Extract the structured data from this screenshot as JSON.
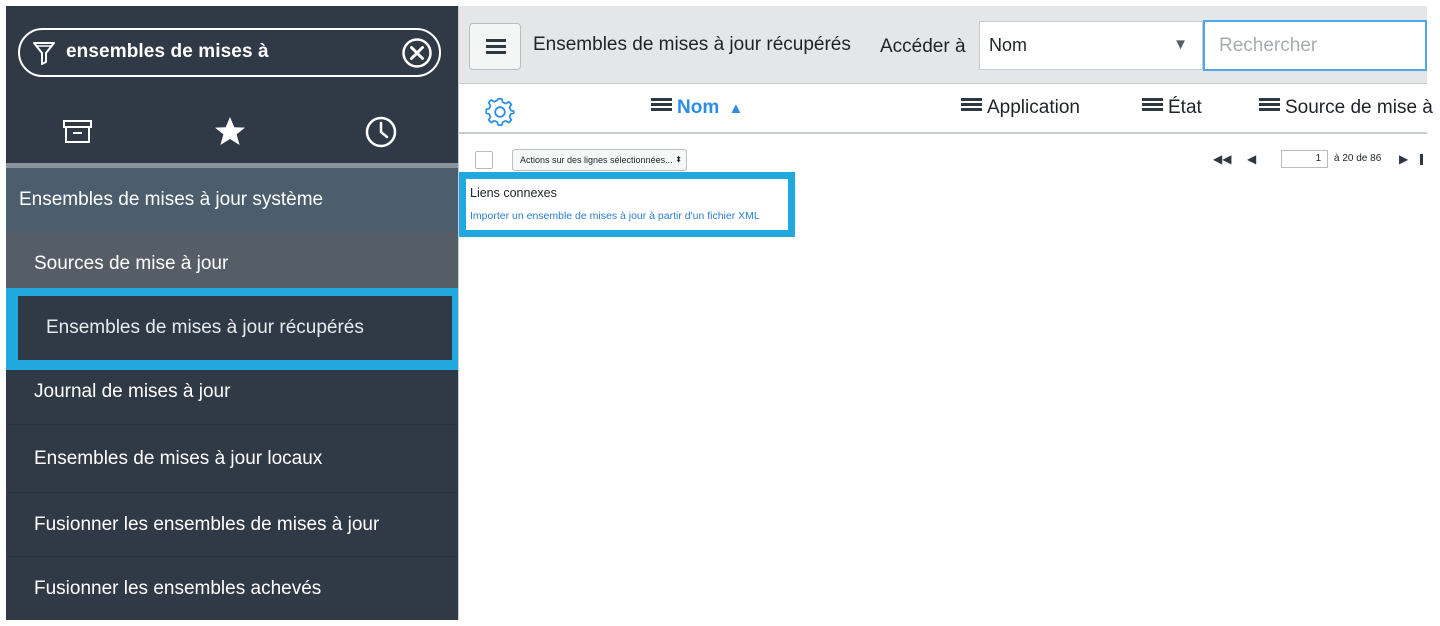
{
  "navigator": {
    "filter_value": "ensembles de mises à",
    "tabs": [
      "all-apps-icon",
      "favorites-icon",
      "history-icon"
    ],
    "items": [
      {
        "label": "Ensembles de mises à jour système",
        "type": "section"
      },
      {
        "label": "Sources de mise à jour",
        "type": "module"
      },
      {
        "label": "Ensembles de mises à jour récupérés",
        "type": "module",
        "selected": true
      },
      {
        "label": "Journal de mises à jour",
        "type": "module"
      },
      {
        "label": "Ensembles de mises à jour locaux",
        "type": "module"
      },
      {
        "label": "Fusionner les ensembles de mises à jour",
        "type": "module"
      },
      {
        "label": "Fusionner les ensembles achevés",
        "type": "module"
      }
    ]
  },
  "list": {
    "title": "Ensembles de mises à jour récupérés",
    "goto_label": "Accéder à",
    "search_field": "Nom",
    "search_placeholder": "Rechercher",
    "columns": [
      {
        "label": "Nom",
        "sorted": "asc"
      },
      {
        "label": "Application"
      },
      {
        "label": "État"
      },
      {
        "label": "Source de mise à"
      }
    ],
    "actions_placeholder": "Actions sur des lignes sélectionnées...",
    "pager": {
      "current_page": "1",
      "range_text": "à 20 de 86"
    },
    "related_links": {
      "title": "Liens connexes",
      "link": "Importer un ensemble de mises à jour à partir d'un fichier XML"
    }
  },
  "colors": {
    "nav_background": "#303a46",
    "section_header": "#4c5d6d",
    "highlight": "#20a8df",
    "accent_blue": "#2b8ee6",
    "link_blue": "#2b7ed1"
  }
}
